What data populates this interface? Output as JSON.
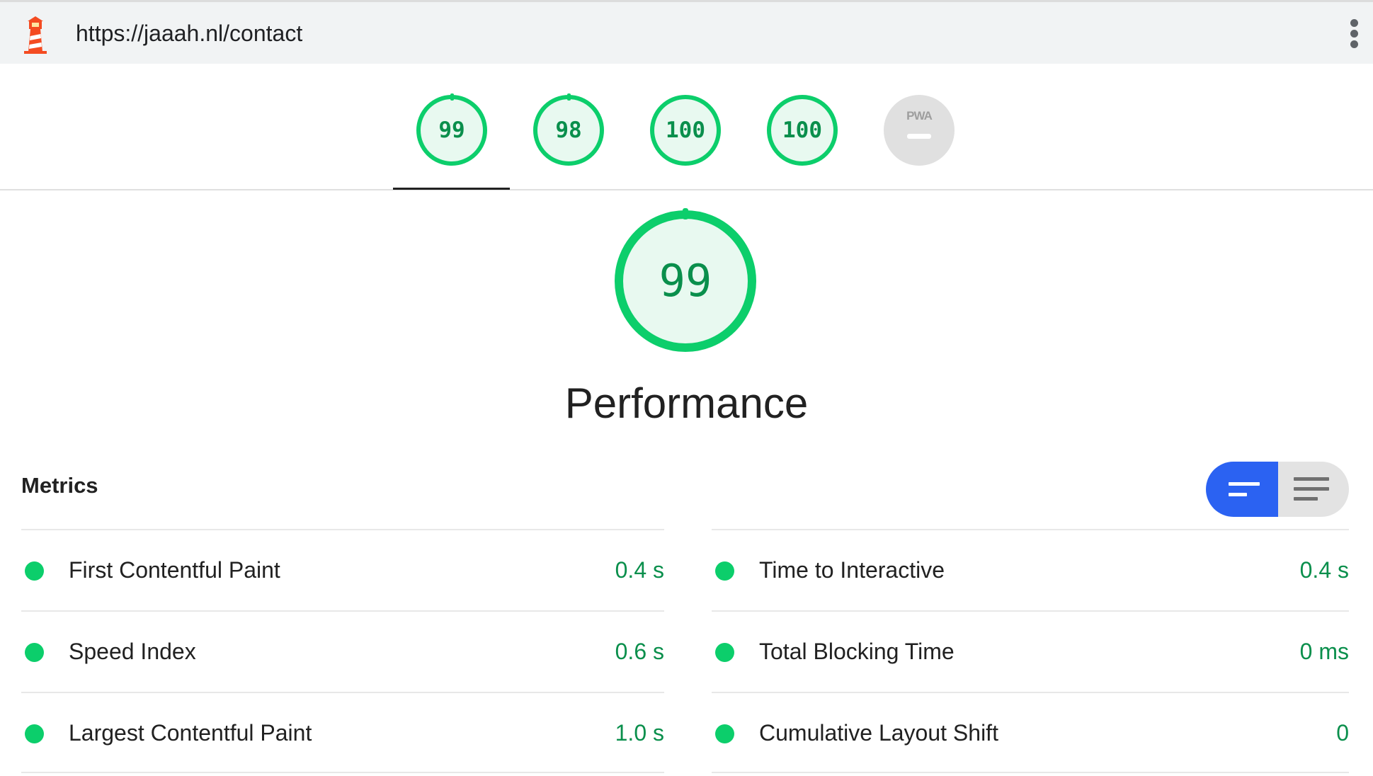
{
  "header": {
    "url": "https://jaaah.nl/contact",
    "logo_icon": "lighthouse-icon",
    "menu_icon": "kebab-menu-icon"
  },
  "gauges": [
    {
      "category": "performance",
      "score": "99"
    },
    {
      "category": "accessibility",
      "score": "98"
    },
    {
      "category": "best-practices",
      "score": "100"
    },
    {
      "category": "seo",
      "score": "100"
    },
    {
      "category": "pwa",
      "label": "PWA",
      "score": "–"
    }
  ],
  "selected_category": {
    "score": "99",
    "title": "Performance"
  },
  "metrics": {
    "title": "Metrics",
    "left": [
      {
        "label": "First Contentful Paint",
        "value": "0.4 s",
        "status": "pass"
      },
      {
        "label": "Speed Index",
        "value": "0.6 s",
        "status": "pass"
      },
      {
        "label": "Largest Contentful Paint",
        "value": "1.0 s",
        "status": "pass"
      }
    ],
    "right": [
      {
        "label": "Time to Interactive",
        "value": "0.4 s",
        "status": "pass"
      },
      {
        "label": "Total Blocking Time",
        "value": "0 ms",
        "status": "pass"
      },
      {
        "label": "Cumulative Layout Shift",
        "value": "0",
        "status": "pass"
      }
    ],
    "toggle_icons": [
      "compact-view-icon",
      "expanded-view-icon"
    ]
  },
  "colors": {
    "pass": "#0cce6b",
    "pass_text": "#0a8f4c",
    "toggle_active": "#2b62f2"
  }
}
